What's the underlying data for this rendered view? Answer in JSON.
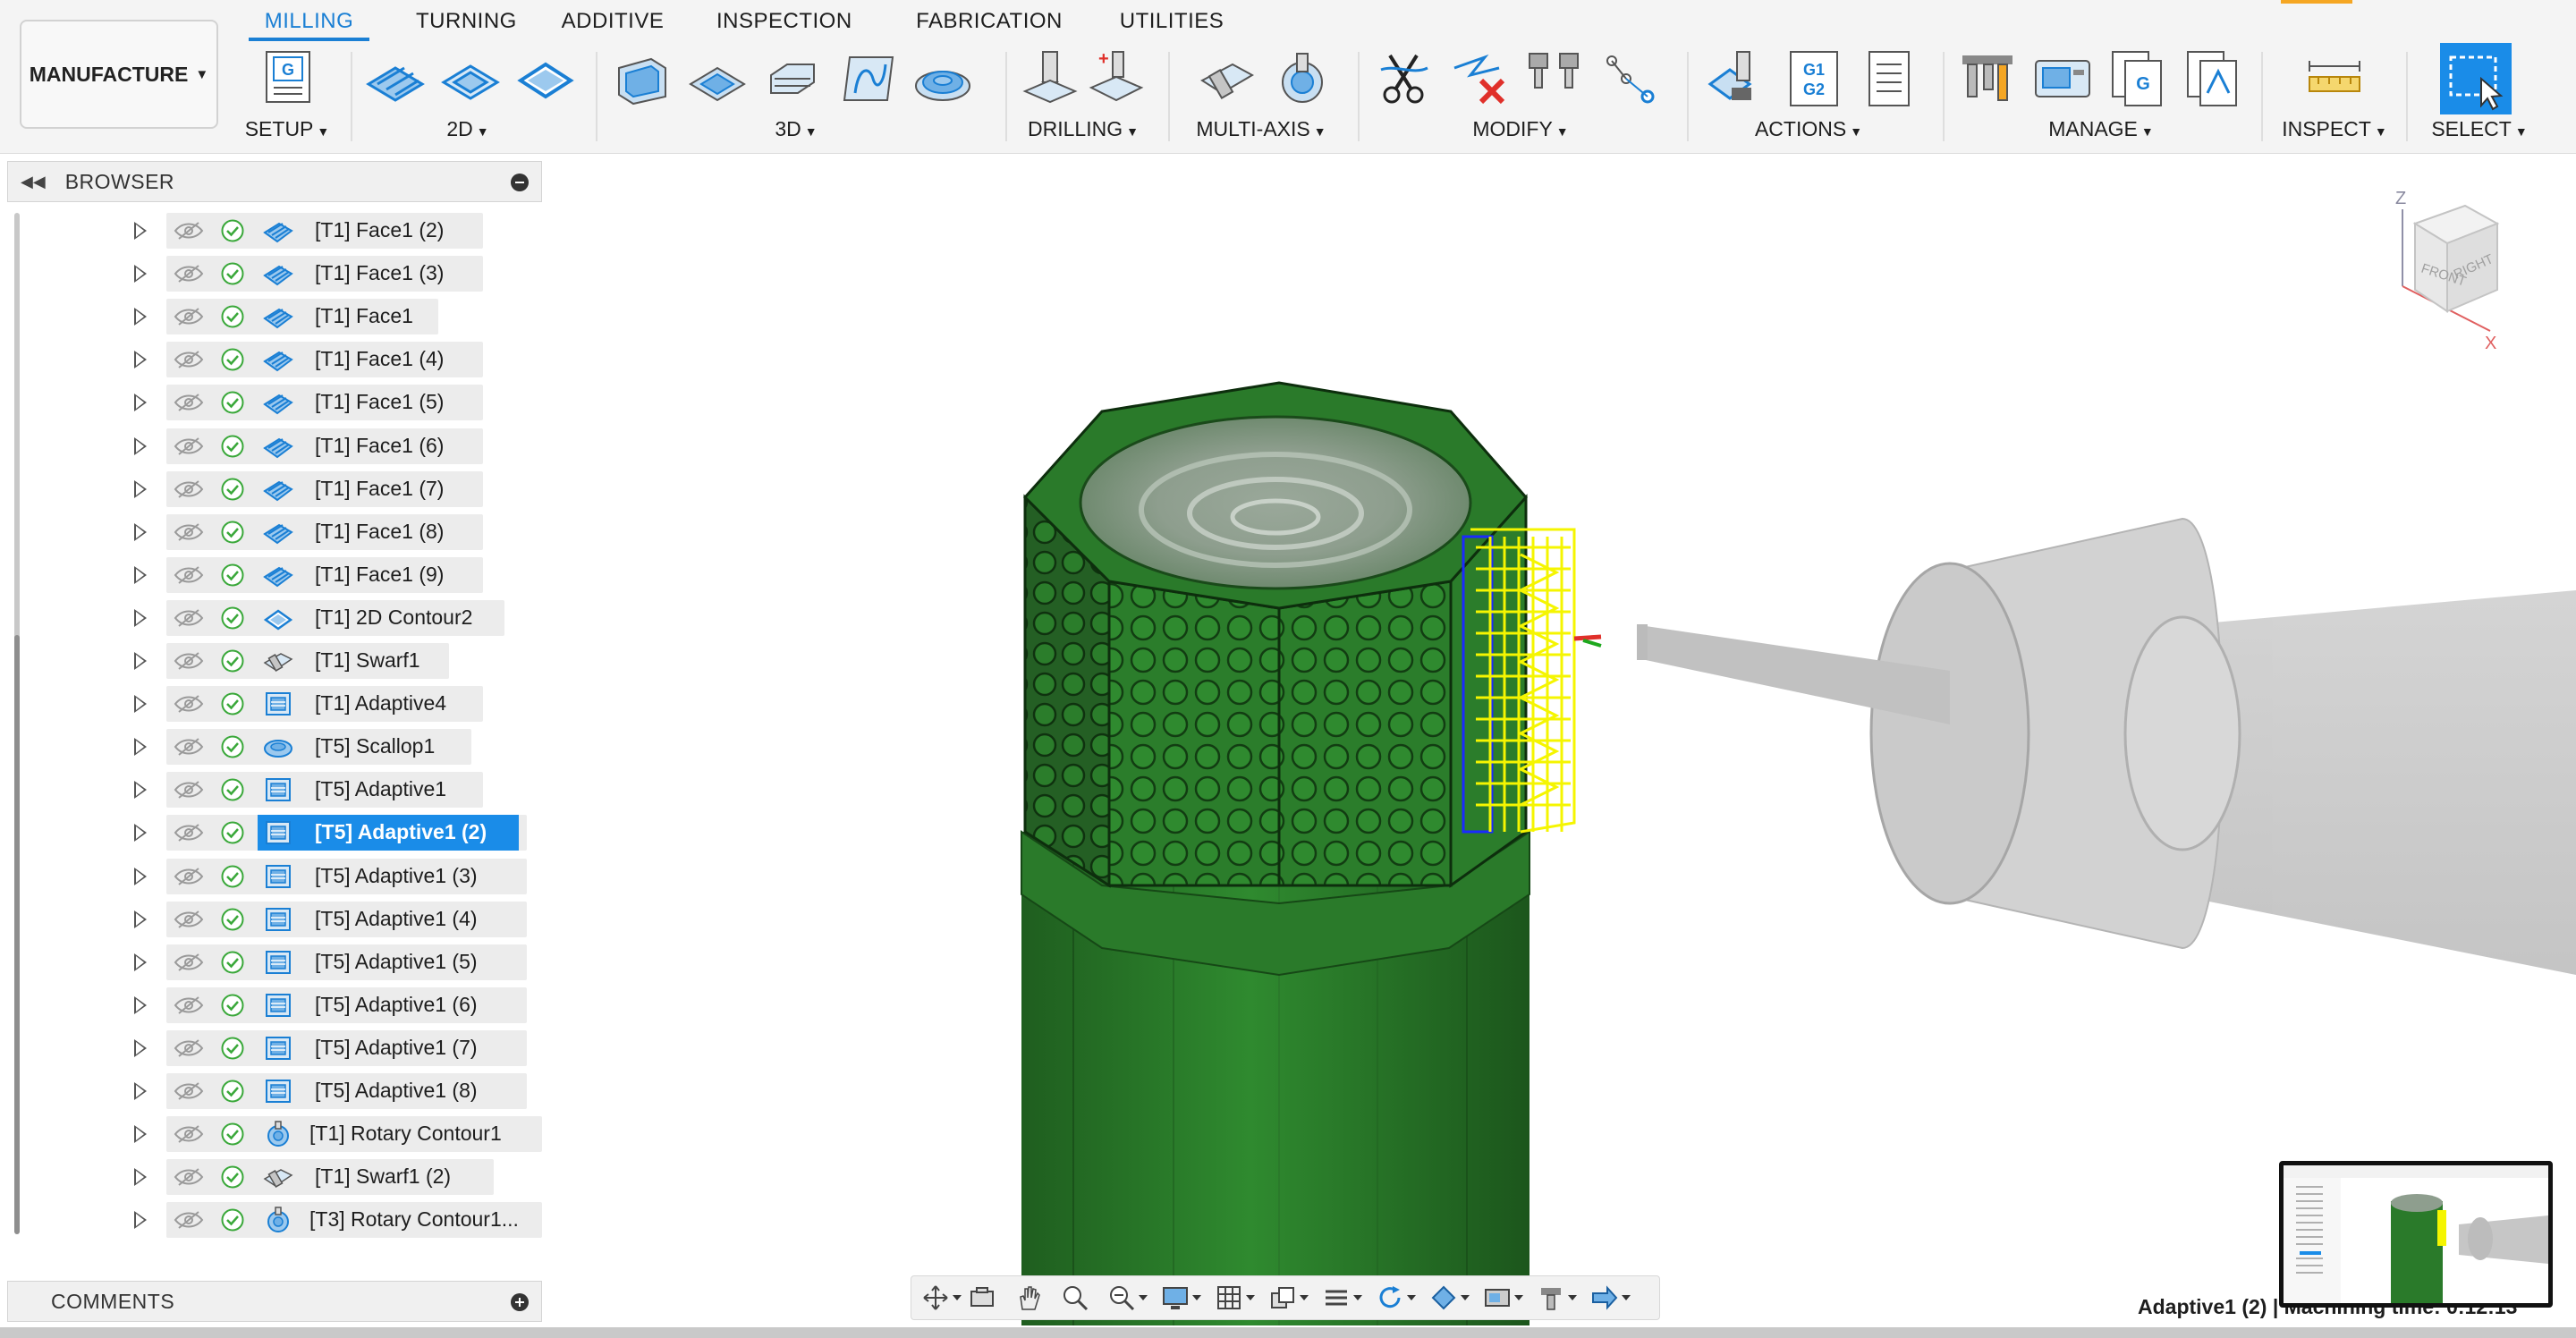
{
  "workspace": {
    "label": "MANUFACTURE"
  },
  "tabs": [
    "MILLING",
    "TURNING",
    "ADDITIVE",
    "INSPECTION",
    "FABRICATION",
    "UTILITIES"
  ],
  "active_tab": "MILLING",
  "groups": {
    "setup": "SETUP",
    "two_d": "2D",
    "three_d": "3D",
    "drilling": "DRILLING",
    "multi_axis": "MULTI-AXIS",
    "modify": "MODIFY",
    "actions": "ACTIONS",
    "manage": "MANAGE",
    "inspect": "INSPECT",
    "select": "SELECT"
  },
  "icon_text": {
    "setup_g": "G",
    "g1g2_top": "G1",
    "g1g2_bottom": "G2",
    "nc_g": "G"
  },
  "browser": {
    "title": "BROWSER",
    "items": [
      {
        "label": "[T1] Face1 (2)",
        "icon": "face-icon"
      },
      {
        "label": "[T1] Face1 (3)",
        "icon": "face-icon"
      },
      {
        "label": "[T1] Face1",
        "icon": "face-icon"
      },
      {
        "label": "[T1] Face1 (4)",
        "icon": "face-icon"
      },
      {
        "label": "[T1] Face1 (5)",
        "icon": "face-icon"
      },
      {
        "label": "[T1] Face1 (6)",
        "icon": "face-icon"
      },
      {
        "label": "[T1] Face1 (7)",
        "icon": "face-icon"
      },
      {
        "label": "[T1] Face1 (8)",
        "icon": "face-icon"
      },
      {
        "label": "[T1] Face1 (9)",
        "icon": "face-icon"
      },
      {
        "label": "[T1] 2D Contour2",
        "icon": "contour-icon"
      },
      {
        "label": "[T1] Swarf1",
        "icon": "swarf-icon"
      },
      {
        "label": "[T1] Adaptive4",
        "icon": "adaptive-icon"
      },
      {
        "label": "[T5] Scallop1",
        "icon": "scallop-icon"
      },
      {
        "label": "[T5] Adaptive1",
        "icon": "adaptive-icon"
      },
      {
        "label": "[T5] Adaptive1 (2)",
        "icon": "adaptive-icon",
        "selected": true
      },
      {
        "label": "[T5] Adaptive1 (3)",
        "icon": "adaptive-icon"
      },
      {
        "label": "[T5] Adaptive1 (4)",
        "icon": "adaptive-icon"
      },
      {
        "label": "[T5] Adaptive1 (5)",
        "icon": "adaptive-icon"
      },
      {
        "label": "[T5] Adaptive1 (6)",
        "icon": "adaptive-icon"
      },
      {
        "label": "[T5] Adaptive1 (7)",
        "icon": "adaptive-icon"
      },
      {
        "label": "[T5] Adaptive1 (8)",
        "icon": "adaptive-icon"
      },
      {
        "label": "[T1] Rotary Contour1",
        "icon": "rotary-icon"
      },
      {
        "label": "[T1] Swarf1 (2)",
        "icon": "swarf-icon"
      },
      {
        "label": "[T3] Rotary Contour1...",
        "icon": "rotary-icon"
      }
    ]
  },
  "comments": {
    "title": "COMMENTS"
  },
  "viewcube": {
    "front": "FRONT",
    "right": "RIGHT",
    "z": "Z",
    "x": "X"
  },
  "status": {
    "text": "Adaptive1 (2) | Machining time: 0:12:13"
  },
  "colors": {
    "accent": "#1a7fd4",
    "selection": "#1a8ce8",
    "part": "#2a7a2a",
    "toolpath": "#f5f500"
  }
}
